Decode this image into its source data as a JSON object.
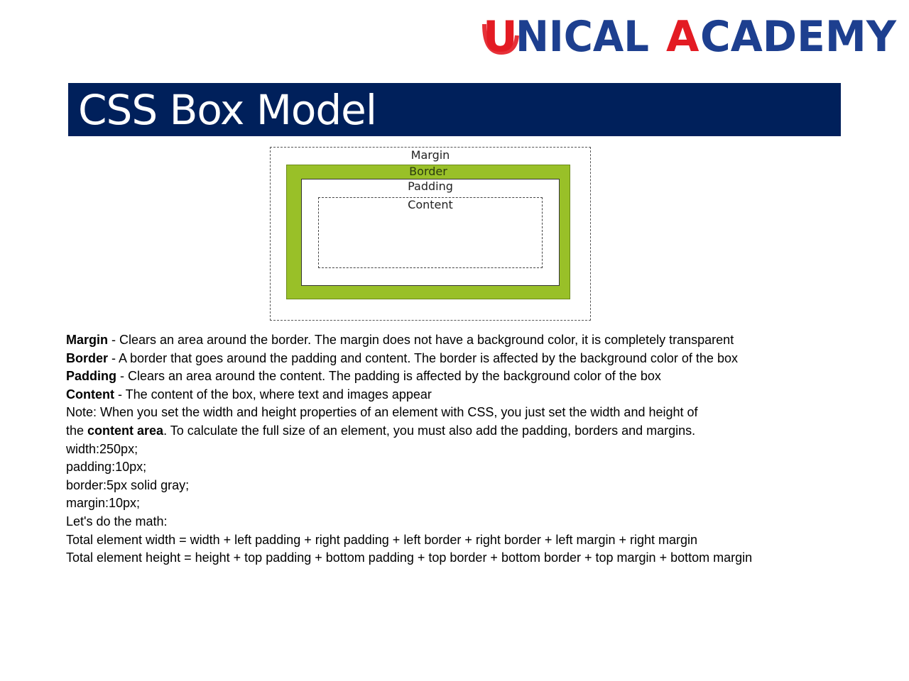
{
  "logo": {
    "text": "UNICAL ACADEMY",
    "colors": {
      "u": "#e31b23",
      "blue": "#1d3f8f",
      "a": "#e31b23"
    }
  },
  "title": "CSS Box Model",
  "diagram": {
    "margin_label": "Margin",
    "border_label": "Border",
    "padding_label": "Padding",
    "content_label": "Content",
    "colors": {
      "border_fill": "#99c028",
      "title_bar": "#00205b"
    }
  },
  "definitions": [
    {
      "term": "Margin",
      "text": " - Clears an area around the border. The margin does not have a background color, it is completely transparent"
    },
    {
      "term": "Border",
      "text": " - A border that goes around the padding and content. The border is affected by the background color of the box"
    },
    {
      "term": "Padding",
      "text": " - Clears an area around the content. The padding is affected by the background color of the box"
    },
    {
      "term": "Content",
      "text": " - The content of the box, where text and images appear"
    }
  ],
  "note": {
    "line1": "Note: When you set the width and height properties of an element with CSS, you just set the width and height of",
    "line2_prefix": "the ",
    "line2_bold": "content area",
    "line2_suffix": ". To calculate the full size of an element, you must also add the padding, borders and margins."
  },
  "code_lines": [
    "width:250px;",
    "padding:10px;",
    "border:5px solid gray;",
    "margin:10px;"
  ],
  "math": {
    "intro": "Let's do the math:",
    "width_formula": "Total element width = width + left padding + right padding + left border + right border + left margin + right margin",
    "height_formula": "Total element height = height + top padding + bottom padding + top border + bottom border + top margin + bottom margin"
  }
}
